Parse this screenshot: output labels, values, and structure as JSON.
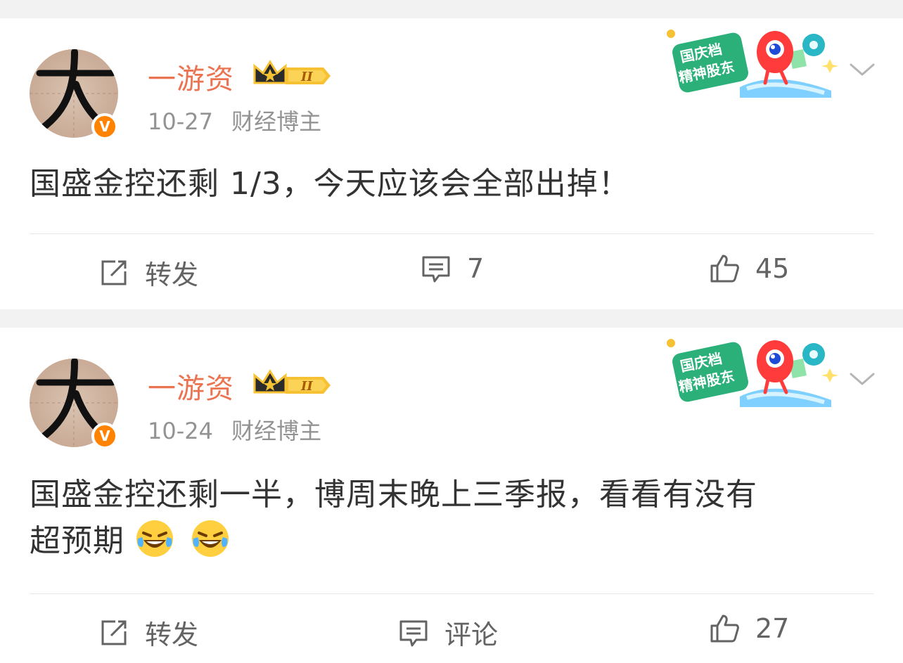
{
  "posts": [
    {
      "username": "一游资",
      "level": "II",
      "time": "10-27",
      "category": "财经博主",
      "verified_badge": "V",
      "event_badge": {
        "line1": "国庆档",
        "line2": "精神股东"
      },
      "content": "国盛金控还剩 1/3，今天应该会全部出掉！",
      "actions": {
        "repost": "转发",
        "comment": "7",
        "like": "45"
      }
    },
    {
      "username": "一游资",
      "level": "II",
      "time": "10-24",
      "category": "财经博主",
      "verified_badge": "V",
      "event_badge": {
        "line1": "国庆档",
        "line2": "精神股东"
      },
      "content_line1": "国盛金控还剩一半，博周末晚上三季报，看看有没有",
      "content_line2": "超预期",
      "emojis": [
        "laugh-cry-emoji",
        "laugh-cry-emoji"
      ],
      "actions": {
        "repost": "转发",
        "comment": "评论",
        "like": "27"
      }
    }
  ],
  "colors": {
    "username": "#eb7350",
    "verified": "#ff8200",
    "meta": "#939393",
    "action": "#636363",
    "badge_gold": "#f6c233"
  }
}
